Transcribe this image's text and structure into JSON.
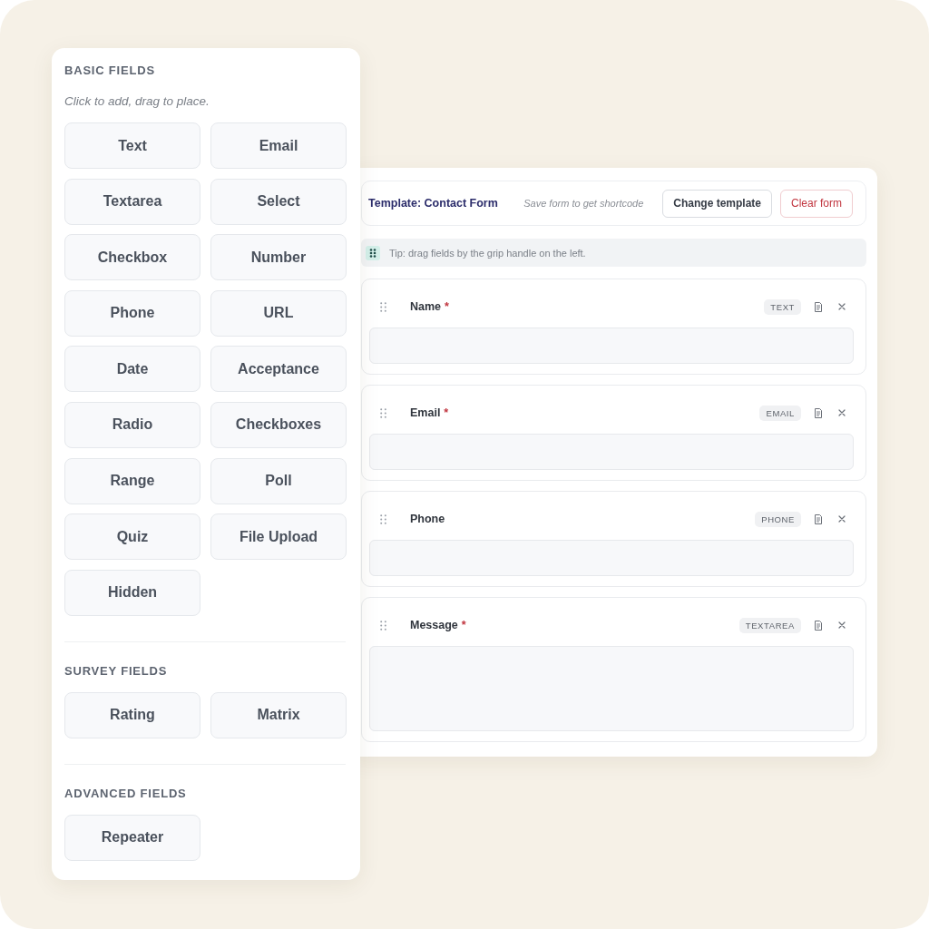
{
  "palette": {
    "sections": [
      {
        "title": "BASIC FIELDS",
        "hint": "Click to add, drag to place.",
        "items": [
          "Text",
          "Email",
          "Textarea",
          "Select",
          "Checkbox",
          "Number",
          "Phone",
          "URL",
          "Date",
          "Acceptance",
          "Radio",
          "Checkboxes",
          "Range",
          "Poll",
          "Quiz",
          "File Upload",
          "Hidden"
        ]
      },
      {
        "title": "SURVEY FIELDS",
        "items": [
          "Rating",
          "Matrix"
        ]
      },
      {
        "title": "ADVANCED FIELDS",
        "items": [
          "Repeater"
        ]
      }
    ]
  },
  "builder": {
    "template_label": "Template: Contact Form",
    "shortcode_hint": "Save form to get shortcode",
    "buttons": [
      {
        "label": "Change template",
        "kind": "default"
      },
      {
        "label": "Clear form",
        "kind": "danger"
      }
    ],
    "tip": "Tip: drag fields by the grip handle on the left.",
    "fields": [
      {
        "label": "Name",
        "required_mark": "*",
        "type_badge": "TEXT",
        "kind": "input"
      },
      {
        "label": "Email",
        "required_mark": "*",
        "type_badge": "EMAIL",
        "kind": "input"
      },
      {
        "label": "Phone",
        "type_badge": "PHONE",
        "kind": "input"
      },
      {
        "label": "Message",
        "required_mark": "*",
        "type_badge": "TEXTAREA",
        "kind": "textarea"
      }
    ]
  }
}
